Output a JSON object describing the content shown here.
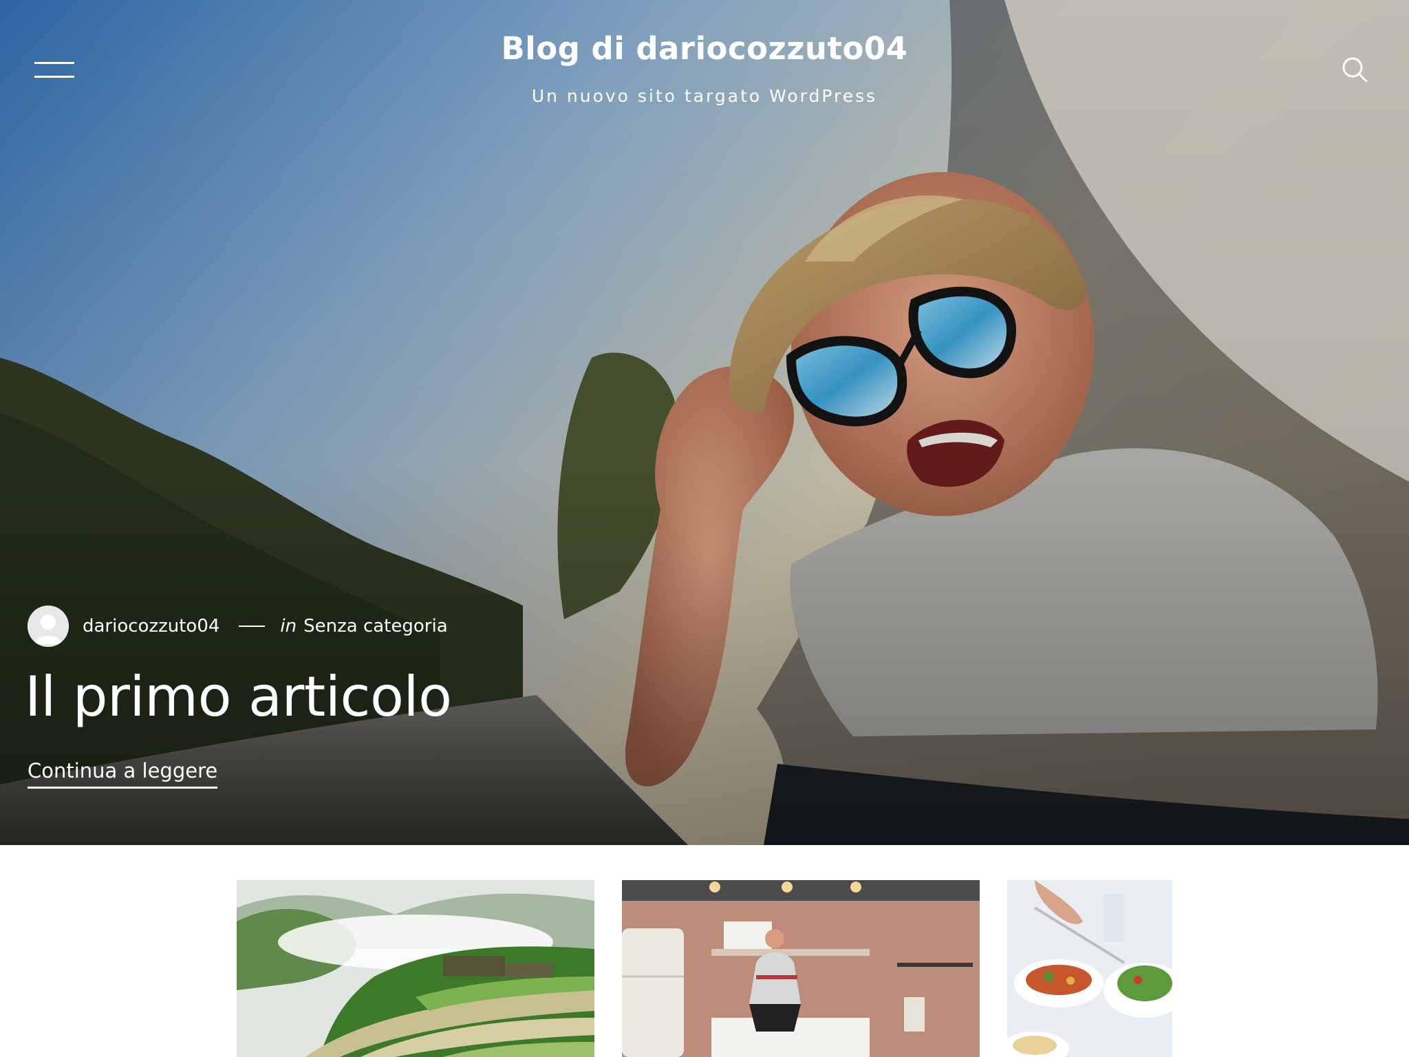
{
  "header": {
    "site_title": "Blog di dariocozzuto04",
    "tagline": "Un nuovo sito targato WordPress",
    "menu_icon": "hamburger-menu-icon",
    "search_icon": "search-icon"
  },
  "hero_post": {
    "author": "dariocozzuto04",
    "category_prefix": "in",
    "category": "Senza categoria",
    "title": "Il primo articolo",
    "read_more": "Continua a leggere"
  },
  "cards": [
    {
      "image": "rice-terraces-photo"
    },
    {
      "image": "kitchen-woman-photo"
    },
    {
      "image": "food-table-photo"
    }
  ],
  "colors": {
    "text_on_hero": "#ffffff",
    "page_background": "#ffffff"
  }
}
